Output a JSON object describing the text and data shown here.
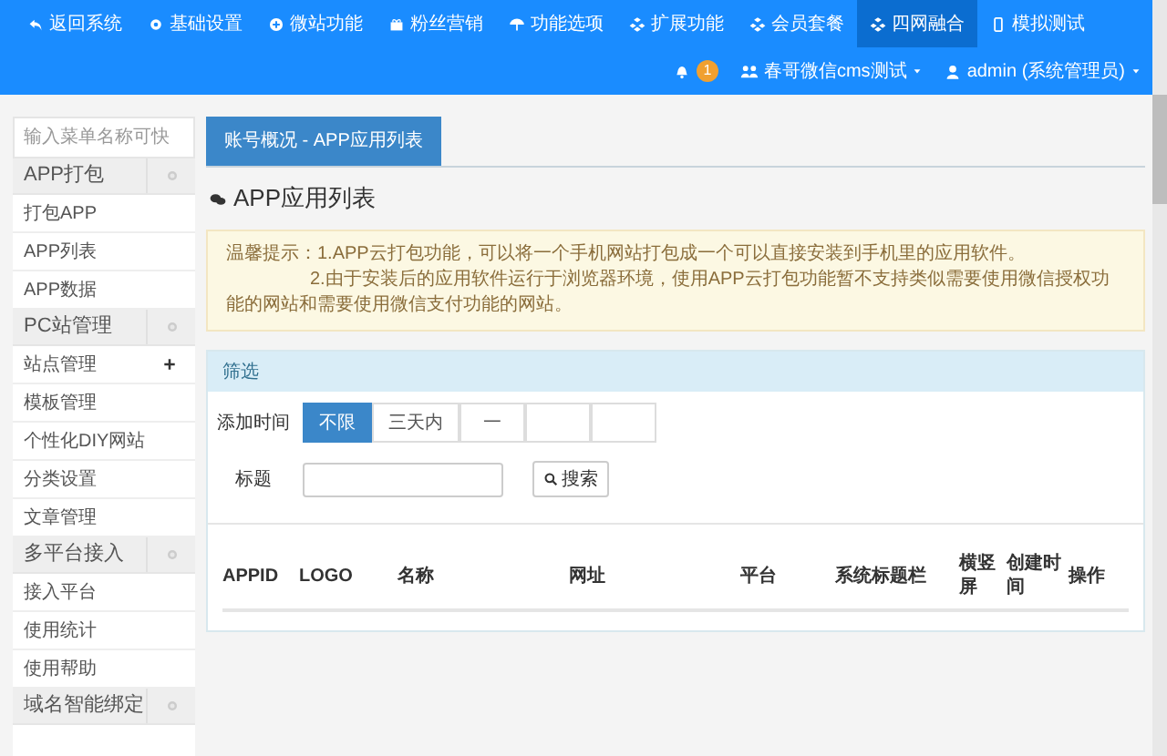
{
  "top_nav": [
    {
      "kind": "undo",
      "label": "返回系统",
      "selected": false
    },
    {
      "kind": "gear",
      "label": "基础设置",
      "selected": false
    },
    {
      "kind": "plus-circle",
      "label": "微站功能",
      "selected": false
    },
    {
      "kind": "gift",
      "label": "粉丝营销",
      "selected": false
    },
    {
      "kind": "umbrella",
      "label": "功能选项",
      "selected": false
    },
    {
      "kind": "cubes",
      "label": "扩展功能",
      "selected": false
    },
    {
      "kind": "cubes",
      "label": "会员套餐",
      "selected": false
    },
    {
      "kind": "cubes",
      "label": "四网融合",
      "selected": true
    },
    {
      "kind": "mobile",
      "label": "模拟测试",
      "selected": false
    }
  ],
  "user_bar": {
    "notifications": "1",
    "account": "春哥微信cms测试",
    "user": "admin (系统管理员)"
  },
  "sidebar": {
    "search": {
      "placeholder": "输入菜单名称可快"
    },
    "groups": [
      {
        "title": "APP打包",
        "items": [
          {
            "label": "打包APP",
            "plus": false
          },
          {
            "label": "APP列表",
            "plus": false
          },
          {
            "label": "APP数据",
            "plus": false
          }
        ]
      },
      {
        "title": "PC站管理",
        "items": [
          {
            "label": "站点管理",
            "plus": true
          },
          {
            "label": "模板管理",
            "plus": false
          },
          {
            "label": "个性化DIY网站",
            "plus": false
          },
          {
            "label": "分类设置",
            "plus": false
          },
          {
            "label": "文章管理",
            "plus": false
          }
        ]
      },
      {
        "title": "多平台接入",
        "items": [
          {
            "label": "接入平台",
            "plus": false
          },
          {
            "label": "使用统计",
            "plus": false
          },
          {
            "label": "使用帮助",
            "plus": false
          }
        ]
      },
      {
        "title": "域名智能绑定"
      }
    ]
  },
  "tabs": [
    {
      "label": "账号概况 - APP应用列表",
      "selected": true
    }
  ],
  "page_title": "APP应用列表",
  "notice": {
    "line_1": "温馨提示：1.APP云打包功能，可以将一个手机网站打包成一个可以直接安装到手机里的应用软件。",
    "line_2": "2.由于安装后的应用软件运行于浏览器环境，使用APP云打包功能暂不支持类似需要使用微信授权功能的网站和需要使用微信支付功能的网站。"
  },
  "filter": {
    "title": "筛选",
    "time_label": "添加时间",
    "time_options": [
      {
        "label": "不限",
        "selected": true
      },
      {
        "label": "三天内",
        "selected": false
      },
      {
        "label": "一",
        "selected": false
      },
      {
        "selected": false
      },
      {
        "selected": false
      }
    ],
    "title_label": "标题",
    "search_button": "搜索"
  },
  "table": {
    "columns": [
      "APPID",
      "LOGO",
      "名称",
      "网址",
      "平台",
      "系统标题栏",
      "横竖屏",
      "创建时间",
      "操作"
    ]
  }
}
